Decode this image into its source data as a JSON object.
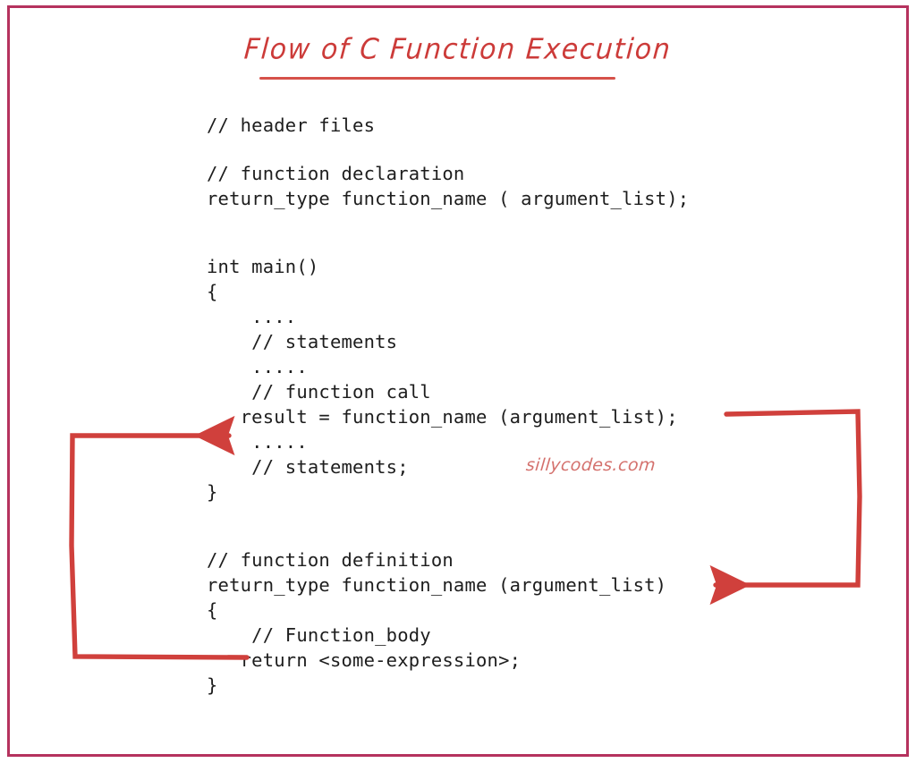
{
  "diagram": {
    "title": "Flow of C Function Execution",
    "watermark": "sillycodes.com",
    "border_color": "#b5325e",
    "accent_color": "#cc3b39",
    "arrow_color": "#d0403c",
    "code_color": "#1d1d1d",
    "background_color": "#ffffff"
  },
  "code": {
    "line_01": "// header files",
    "line_02": "// function declaration",
    "line_03": "return_type function_name ( argument_list);",
    "line_04": "int main()",
    "line_05": "{",
    "line_06": "    ....",
    "line_07": "    // statements",
    "line_08": "    .....",
    "line_09": "    // function call",
    "line_10": "   result = function_name (argument_list);",
    "line_11": "    .....",
    "line_12": "    // statements;",
    "line_13": "}",
    "line_14": "// function definition",
    "line_15": "return_type function_name (argument_list)",
    "line_16": "{",
    "line_17": "    // Function_body",
    "line_18": "   return <some-expression>;",
    "line_19": "}"
  },
  "arrows": {
    "call_arrow": {
      "name": "function-call-arrow",
      "description": "from the function call statement, around the right side, pointing to the function definition header",
      "from_label": "result = function_name (argument_list);",
      "to_label": "return_type function_name (argument_list)",
      "direction": "right-down-left"
    },
    "return_arrow": {
      "name": "function-return-arrow",
      "description": "from the return statement, around the left side, pointing back to the statement after the function call",
      "from_label": "return <some-expression>;",
      "to_label": ".....",
      "direction": "left-up-right"
    }
  }
}
